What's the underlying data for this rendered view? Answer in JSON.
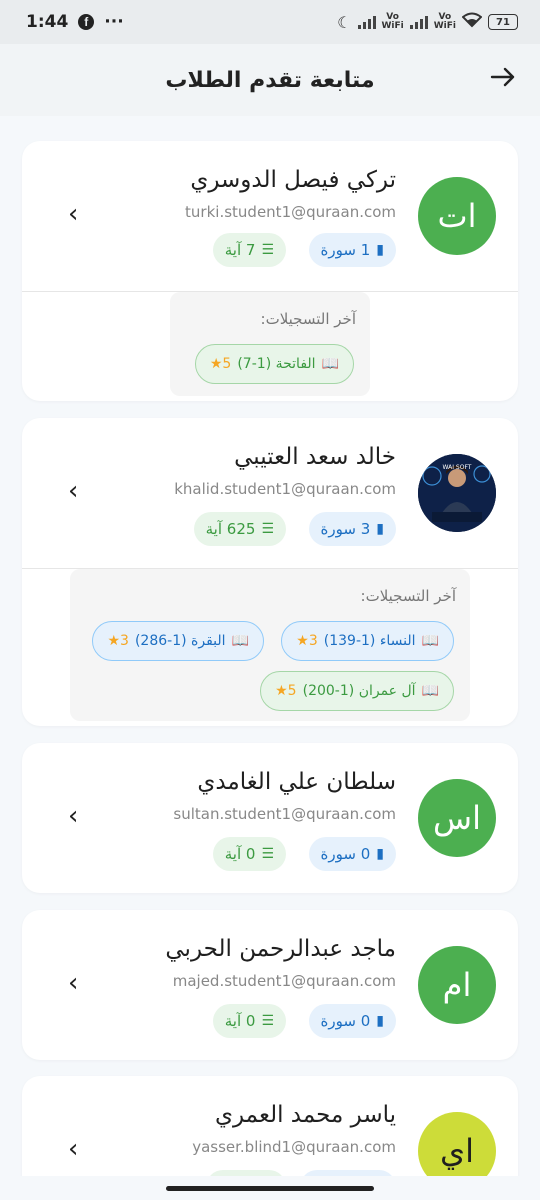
{
  "status": {
    "time": "1:44",
    "fb": "f",
    "dots": "···",
    "vo1": "Vo",
    "wifi1": "WiFi",
    "vo2": "Vo",
    "wifi2": "WiFi",
    "battery": "71"
  },
  "appbar": {
    "title": "متابعة تقدم الطلاب",
    "back_icon": "arrow-right"
  },
  "recent_label": "آخر التسجيلات:",
  "students": [
    {
      "initials": "ات",
      "name": "تركي فيصل الدوسري",
      "email": "turki.student1@quraan.com",
      "surahs": "1 سورة",
      "ayahs": "7 آية",
      "recent": [
        {
          "text": "الفاتحة (1-7)",
          "stars": "5★"
        }
      ]
    },
    {
      "initials": "",
      "name": "خالد سعد العتيبي",
      "email": "khalid.student1@quraan.com",
      "surahs": "3 سورة",
      "ayahs": "625 آية",
      "recent": [
        {
          "text": "النساء (1-139)",
          "stars": "3★"
        },
        {
          "text": "البقرة (1-286)",
          "stars": "3★"
        },
        {
          "text": "آل عمران (1-200)",
          "stars": "5★"
        }
      ]
    },
    {
      "initials": "اس",
      "name": "سلطان علي الغامدي",
      "email": "sultan.student1@quraan.com",
      "surahs": "0 سورة",
      "ayahs": "0 آية"
    },
    {
      "initials": "ام",
      "name": "ماجد عبدالرحمن الحربي",
      "email": "majed.student1@quraan.com",
      "surahs": "0 سورة",
      "ayahs": "0 آية"
    },
    {
      "initials": "اي",
      "name": "ياسر محمد العمري",
      "email": "yasser.blind1@quraan.com"
    }
  ],
  "colors": {
    "avatar_green": "#4caf50",
    "avatar_lime": "#cddc39",
    "chip_blue": "#1d6fc2",
    "chip_green": "#3b9a40",
    "star": "#f5a623"
  }
}
